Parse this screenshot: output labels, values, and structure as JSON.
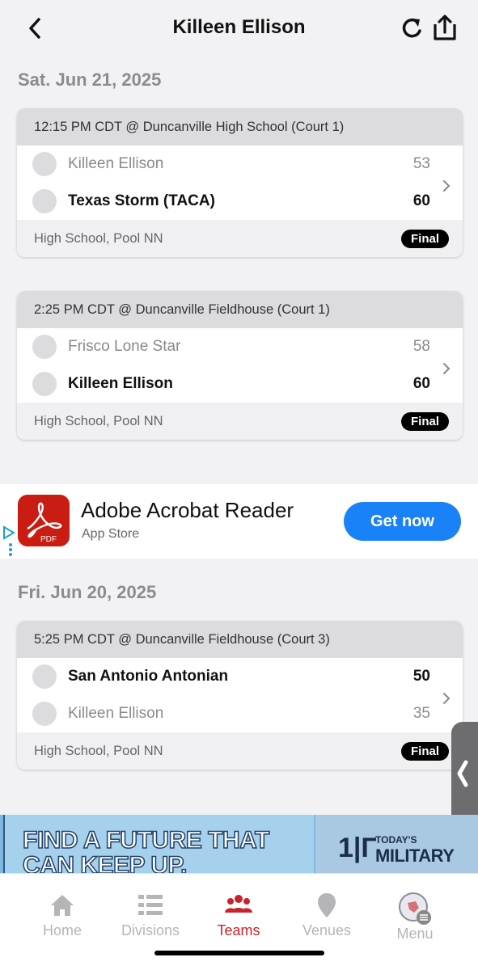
{
  "header": {
    "title": "Killeen Ellison"
  },
  "sections": [
    {
      "date": "Sat. Jun 21, 2025",
      "games": [
        {
          "info": "12:15 PM CDT @ Duncanville High School (Court 1)",
          "teams": [
            {
              "name": "Killeen Ellison",
              "score": "53"
            },
            {
              "name": "Texas Storm (TACA)",
              "score": "60"
            }
          ],
          "division": "High School, Pool NN",
          "status": "Final"
        },
        {
          "info": "2:25 PM CDT @ Duncanville Fieldhouse (Court 1)",
          "teams": [
            {
              "name": "Frisco Lone Star",
              "score": "58"
            },
            {
              "name": "Killeen Ellison",
              "score": "60"
            }
          ],
          "division": "High School, Pool NN",
          "status": "Final"
        }
      ]
    },
    {
      "date": "Fri. Jun 20, 2025",
      "games": [
        {
          "info": "5:25 PM CDT @ Duncanville Fieldhouse (Court 3)",
          "teams": [
            {
              "name": "San Antonio Antonian",
              "score": "50"
            },
            {
              "name": "Killeen Ellison",
              "score": "35"
            }
          ],
          "division": "High School, Pool NN",
          "status": "Final"
        }
      ]
    }
  ],
  "ad": {
    "title": "Adobe Acrobat Reader",
    "subtitle": "App Store",
    "cta": "Get now",
    "logo_text": "PDF"
  },
  "banner": {
    "line1": "FIND A FUTURE THAT",
    "line2": "CAN KEEP UP.",
    "brand_small": "TODAY'S",
    "brand_large": "MILITARY"
  },
  "tabs": [
    {
      "label": "Home",
      "icon": "home-icon"
    },
    {
      "label": "Divisions",
      "icon": "list-icon"
    },
    {
      "label": "Teams",
      "icon": "people-icon",
      "active": true
    },
    {
      "label": "Venues",
      "icon": "map-pin-icon"
    },
    {
      "label": "Menu",
      "icon": "menu-logo-icon"
    }
  ],
  "colors": {
    "accent": "#c8232a",
    "cta": "#1a82f7",
    "badge": "#000000",
    "ad_logo": "#c91c12"
  }
}
